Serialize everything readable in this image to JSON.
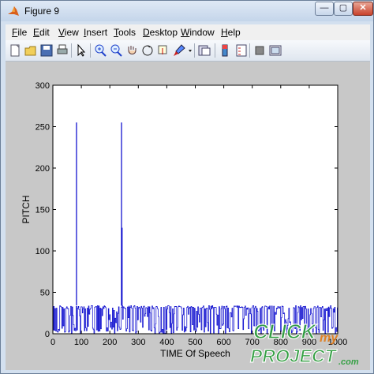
{
  "window": {
    "title": "Figure 9",
    "minimize_label": "—",
    "maximize_label": "▢",
    "close_label": "✕"
  },
  "menu": [
    {
      "label": "File",
      "key": "F",
      "rest": "ile"
    },
    {
      "label": "Edit",
      "key": "E",
      "rest": "dit"
    },
    {
      "label": "View",
      "key": "V",
      "rest": "iew"
    },
    {
      "label": "Insert",
      "key": "I",
      "rest": "nsert"
    },
    {
      "label": "Tools",
      "key": "T",
      "rest": "ools"
    },
    {
      "label": "Desktop",
      "key": "D",
      "rest": "esktop"
    },
    {
      "label": "Window",
      "key": "W",
      "rest": "indow"
    },
    {
      "label": "Help",
      "key": "H",
      "rest": "elp"
    }
  ],
  "toolbar": [
    "new-figure-icon",
    "open-file-icon",
    "save-icon",
    "print-icon",
    "edit-plot-arrow-icon",
    "zoom-in-icon",
    "zoom-out-icon",
    "pan-hand-icon",
    "rotate-3d-icon",
    "data-cursor-icon",
    "brush-icon",
    "brush-dropdown-icon",
    "link-plot-icon",
    "insert-colorbar-icon",
    "insert-legend-icon",
    "hide-plot-tools-icon",
    "show-plot-tools-icon"
  ],
  "watermark": {
    "line1": "CLICK",
    "line2": "my",
    "line3": "PROJECT",
    "line4": ".com"
  },
  "chart_data": {
    "type": "line",
    "xlabel": "TIME Of Speech",
    "ylabel": "PITCH",
    "xlim": [
      0,
      1000
    ],
    "ylim": [
      0,
      300
    ],
    "xticks": [
      0,
      100,
      200,
      300,
      400,
      500,
      600,
      700,
      800,
      900,
      1000
    ],
    "yticks": [
      0,
      50,
      100,
      150,
      200,
      250,
      300
    ],
    "grid": false,
    "series_color": "#0000cc",
    "series": [
      {
        "spikes": [
          {
            "x": 83,
            "y": 255
          },
          {
            "x": 241,
            "y": 255
          },
          {
            "x": 243,
            "y": 128
          }
        ],
        "baseline_band": [
          0,
          34
        ],
        "x_extent": [
          0,
          1000
        ]
      }
    ]
  }
}
